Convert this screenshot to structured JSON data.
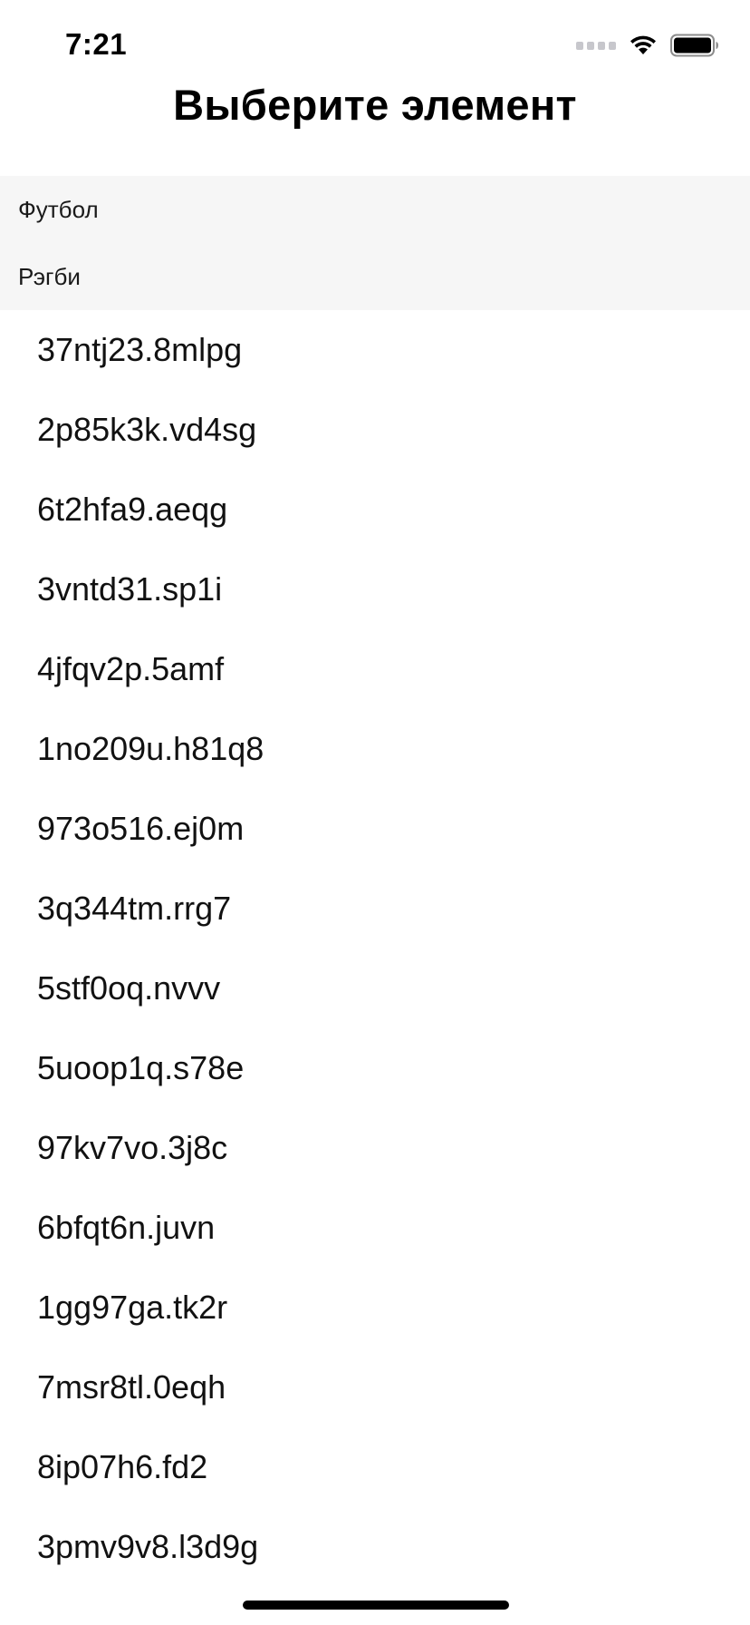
{
  "status_bar": {
    "time": "7:21",
    "icons": [
      "cellular-signal-icon",
      "wifi-icon",
      "battery-icon"
    ]
  },
  "header": {
    "title": "Выберите элемент"
  },
  "categories": [
    {
      "label": "Футбол"
    },
    {
      "label": "Рэгби"
    }
  ],
  "items": [
    {
      "label": "37ntj23.8mlpg"
    },
    {
      "label": "2p85k3k.vd4sg"
    },
    {
      "label": "6t2hfa9.aeqg"
    },
    {
      "label": "3vntd31.sp1i"
    },
    {
      "label": "4jfqv2p.5amf"
    },
    {
      "label": "1no209u.h81q8"
    },
    {
      "label": "973o516.ej0m"
    },
    {
      "label": "3q344tm.rrg7"
    },
    {
      "label": "5stf0oq.nvvv"
    },
    {
      "label": "5uoop1q.s78e"
    },
    {
      "label": "97kv7vo.3j8c"
    },
    {
      "label": "6bfqt6n.juvn"
    },
    {
      "label": "1gg97ga.tk2r"
    },
    {
      "label": "7msr8tl.0eqh"
    },
    {
      "label": "8ip07h6.fd2"
    },
    {
      "label": "3pmv9v8.l3d9g"
    }
  ],
  "colors": {
    "background": "#ffffff",
    "category_background": "#f6f6f6",
    "text": "#000000",
    "signal_inactive": "#c7c7cc"
  }
}
